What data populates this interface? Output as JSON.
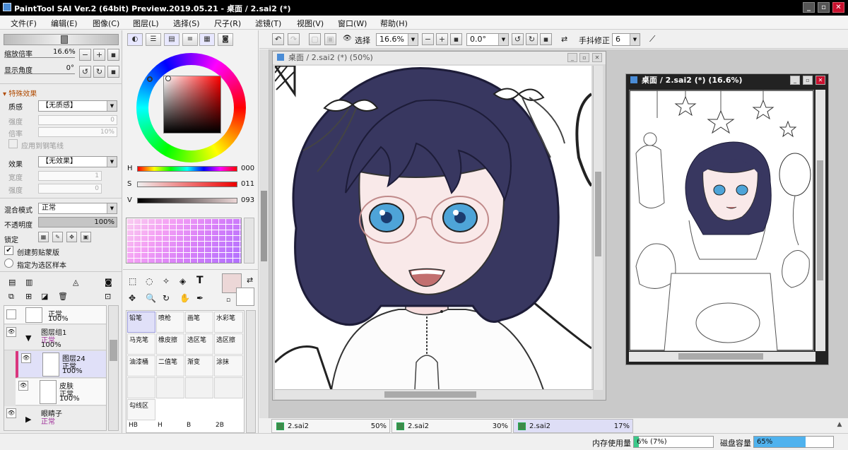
{
  "window": {
    "title": "PaintTool SAI Ver.2 (64bit) Preview.2019.05.21 - 桌面 / 2.sai2 (*)",
    "minimize": "_",
    "maximize": "▫",
    "close": "✕"
  },
  "menu": [
    "文件(F)",
    "编辑(E)",
    "图像(C)",
    "图层(L)",
    "选择(S)",
    "尺子(R)",
    "滤镜(T)",
    "视图(V)",
    "窗口(W)",
    "帮助(H)"
  ],
  "navigator": {
    "zoom_label": "缩放倍率",
    "zoom_value": "16.6%",
    "angle_label": "显示角度",
    "angle_value": "0°"
  },
  "effects": {
    "header": "特殊效果",
    "texture_label": "质感",
    "texture_value": "【无质感】",
    "strength_label": "强度",
    "strength_value": "0",
    "scale_label": "倍率",
    "scale_value": "10%",
    "apply_pen": "应用到钢笔线",
    "effect_label": "效果",
    "effect_value": "【无效果】",
    "width_label": "宽度",
    "width_value": "1",
    "strength2_label": "强度",
    "strength2_value": "0"
  },
  "layer_props": {
    "blend_label": "混合模式",
    "blend_value": "正常",
    "opacity_label": "不透明度",
    "opacity_value": "100%",
    "lock_label": "锁定",
    "clip_label": "创建剪贴蒙版",
    "selsrc_label": "指定为选区样本"
  },
  "layers": [
    {
      "name": "",
      "mode": "正常",
      "opacity": "100%"
    },
    {
      "name": "图层组1",
      "mode": "正常",
      "opacity": "100%"
    },
    {
      "name": "图层24",
      "mode": "正常",
      "opacity": "100%"
    },
    {
      "name": "皮肤",
      "mode": "正常",
      "opacity": "100%"
    },
    {
      "name": "眼睛子",
      "mode": "正常",
      "opacity": ""
    }
  ],
  "color": {
    "h_label": "H",
    "h_value": "000",
    "s_label": "S",
    "s_value": "011",
    "v_label": "V",
    "v_value": "093",
    "h": 0,
    "s": 0.11,
    "v": 0.93,
    "primary": "#ecd7d7"
  },
  "tools": {
    "text_tool": "T"
  },
  "brushes": [
    [
      "铅笔",
      "喷枪",
      "画笔",
      "水彩笔"
    ],
    [
      "马克笔",
      "橡皮擦",
      "选区笔",
      "选区擦"
    ],
    [
      "油漆桶",
      "二值笔",
      "渐变",
      "涂抹"
    ]
  ],
  "brush_row_extra": "勾线区",
  "brush_sizes": [
    "HB",
    "H",
    "B",
    "2B"
  ],
  "canvas_toolbar": {
    "select_label": "选择",
    "zoom_value": "16.6%",
    "angle_value": "0.0°",
    "stabilizer_label": "手抖修正",
    "stabilizer_value": "6"
  },
  "windows": [
    {
      "title": "桌面 / 2.sai2 (*) (50%)"
    },
    {
      "title": "桌面 / 2.sai2 (*) (16.6%)"
    }
  ],
  "tabs": [
    {
      "name": "2.sai2",
      "zoom": "50%"
    },
    {
      "name": "2.sai2",
      "zoom": "30%"
    },
    {
      "name": "2.sai2",
      "zoom": "17%"
    }
  ],
  "status": {
    "memory_label": "内存使用量",
    "memory_value": "6% (7%)",
    "memory_level": 6,
    "disk_label": "磁盘容量",
    "disk_value": "65%",
    "disk_level": 65
  },
  "colors": {
    "accent": "#5b4a9e",
    "selected": "#e0e0f8",
    "hair": "#383760",
    "skin": "#f9e9e9",
    "eye": "#4ea4d8",
    "status_disk": "#4fb2ee",
    "status_mem": "#3bc98a"
  }
}
